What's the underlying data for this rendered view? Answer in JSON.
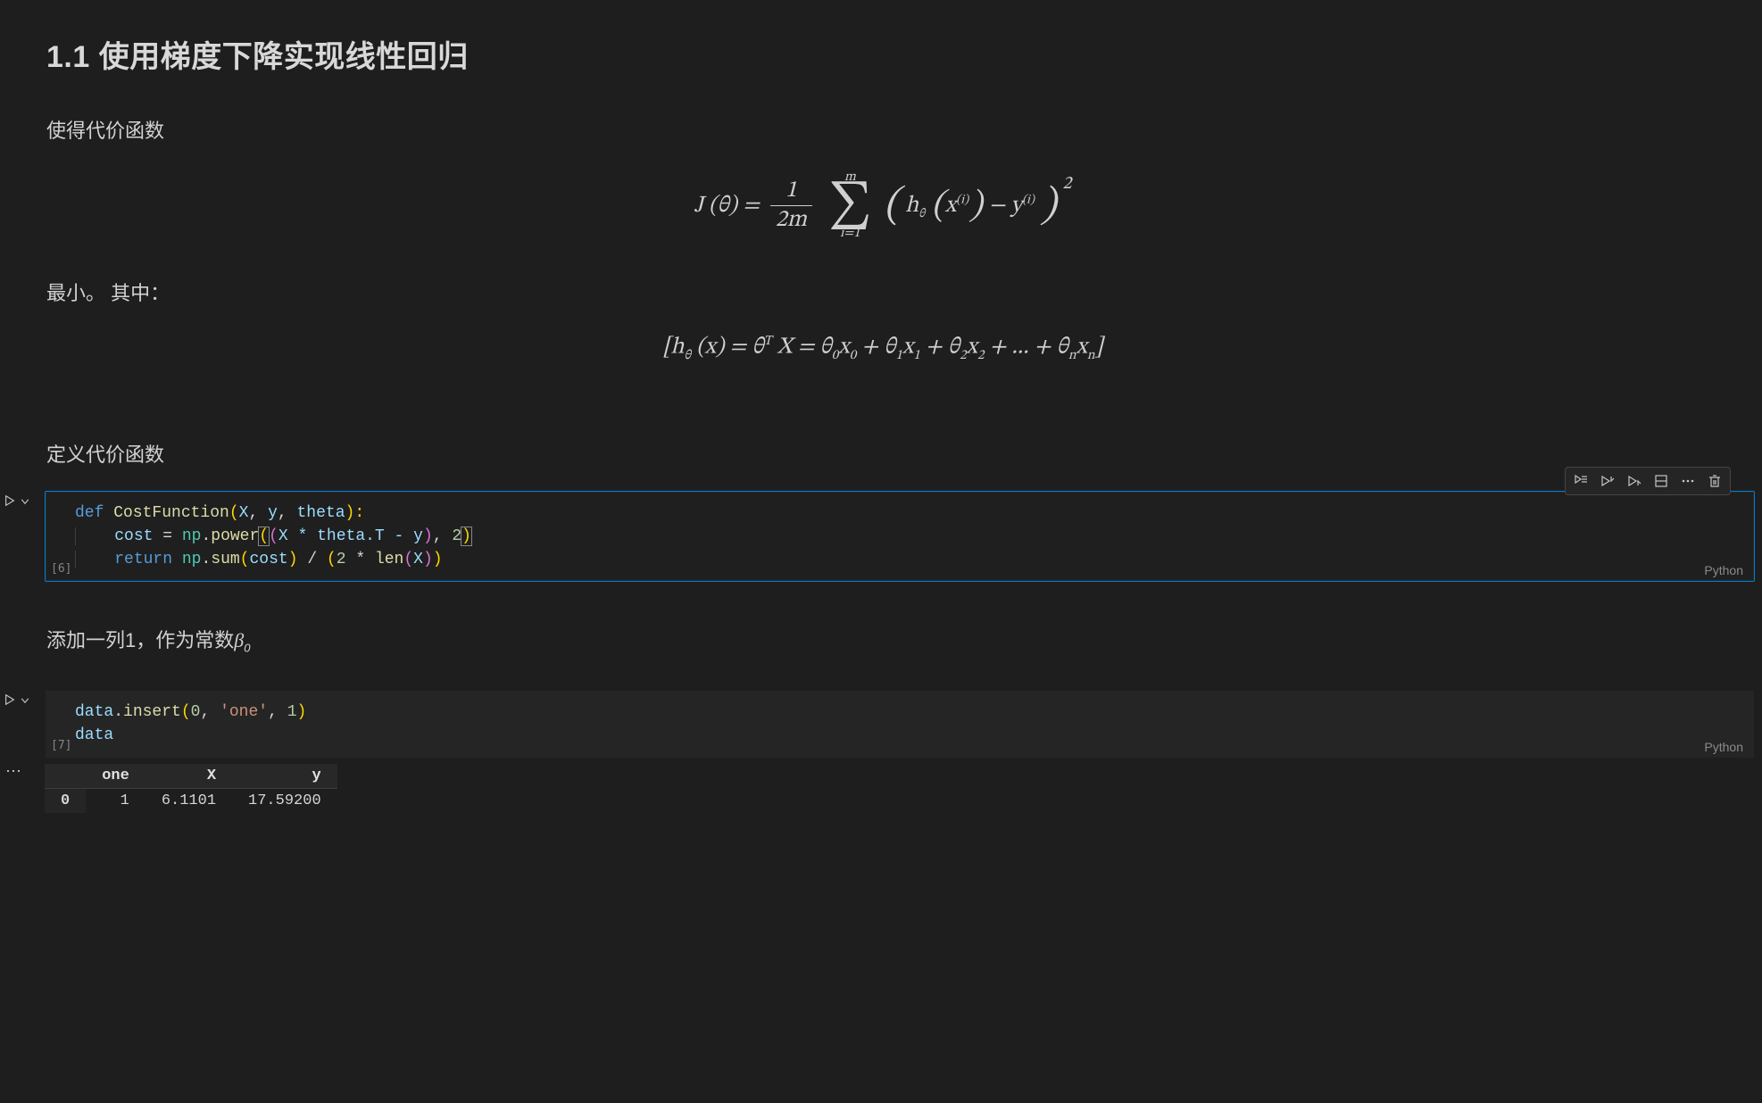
{
  "md1": {
    "h1": "1.1 使用梯度下降实现线性回归",
    "p1": "使得代价函数",
    "eq1_left": "J (θ) =",
    "eq1_frac_num": "1",
    "eq1_frac_den": "2m",
    "eq1_sum_top": "m",
    "eq1_sum_bot": "i=1",
    "eq1_inner_h": "h",
    "eq1_theta": "θ",
    "eq1_x": "x",
    "eq1_i": "(i)",
    "eq1_minus": " − ",
    "eq1_y": "y",
    "eq1_sq": "2",
    "p2": "最小。 其中：",
    "eq2_text_before": "[h",
    "eq2_theta": "θ",
    "eq2_paren_x": " (x) = θ",
    "eq2_T": "T",
    "eq2_X": " X = θ",
    "eq2_0": "0",
    "eq2_x0": "x",
    "eq2_plus": " + θ",
    "eq2_1": "1",
    "eq2_x1": "x",
    "eq2_2": "2",
    "eq2_x2": "x",
    "eq2_dots": " + ... + θ",
    "eq2_n": "n",
    "eq2_xn": "x",
    "eq2_close": "]"
  },
  "md2": {
    "p": "定义代价函数"
  },
  "md3": {
    "p_main": "添加一列1，作为常数",
    "p_beta": "β",
    "p_beta_sub": "0"
  },
  "cell1": {
    "exec": "[6]",
    "language": "Python",
    "code_l1_def": "def",
    "code_l1_fn": " CostFunction",
    "code_l1_open": "(",
    "code_l1_X": "X",
    "code_l1_c1": ", ",
    "code_l1_y": "y",
    "code_l1_c2": ", ",
    "code_l1_theta": "theta",
    "code_l1_close": "):",
    "code_l2_cost": "cost",
    "code_l2_eq": " = ",
    "code_l2_np": "np",
    "code_l2_dot": ".",
    "code_l2_power": "power",
    "code_l2_b1": "(",
    "code_l2_b2": "(",
    "code_l2_expr": "X * theta.T - y",
    "code_l2_b2c": ")",
    "code_l2_comma": ", ",
    "code_l2_two": "2",
    "code_l2_b1c": ")",
    "code_l3_ret": "return",
    "code_l3_sp": " ",
    "code_l3_np": "np",
    "code_l3_dot": ".",
    "code_l3_sum": "sum",
    "code_l3_b1": "(",
    "code_l3_cost": "cost",
    "code_l3_b1c": ")",
    "code_l3_div": " / ",
    "code_l3_b2": "(",
    "code_l3_two": "2",
    "code_l3_mul": " * ",
    "code_l3_len": "len",
    "code_l3_b3": "(",
    "code_l3_X": "X",
    "code_l3_b3c": ")",
    "code_l3_b2c": ")"
  },
  "cell2": {
    "exec": "[7]",
    "language": "Python",
    "l1_data": "data",
    "l1_dot": ".",
    "l1_insert": "insert",
    "l1_b": "(",
    "l1_z": "0",
    "l1_c1": ", ",
    "l1_str": "'one'",
    "l1_c2": ", ",
    "l1_one": "1",
    "l1_bc": ")",
    "l2_data": "data"
  },
  "output_table": {
    "columns": [
      "one",
      "X",
      "y"
    ],
    "rows": [
      {
        "idx": "0",
        "one": "1",
        "X": "6.1101",
        "y": "17.59200"
      }
    ]
  },
  "toolbar": {
    "run_by_line": "run-by-line",
    "execute_above": "execute-above",
    "execute_below": "execute-below",
    "split": "split-cell",
    "more": "more",
    "delete": "delete"
  }
}
